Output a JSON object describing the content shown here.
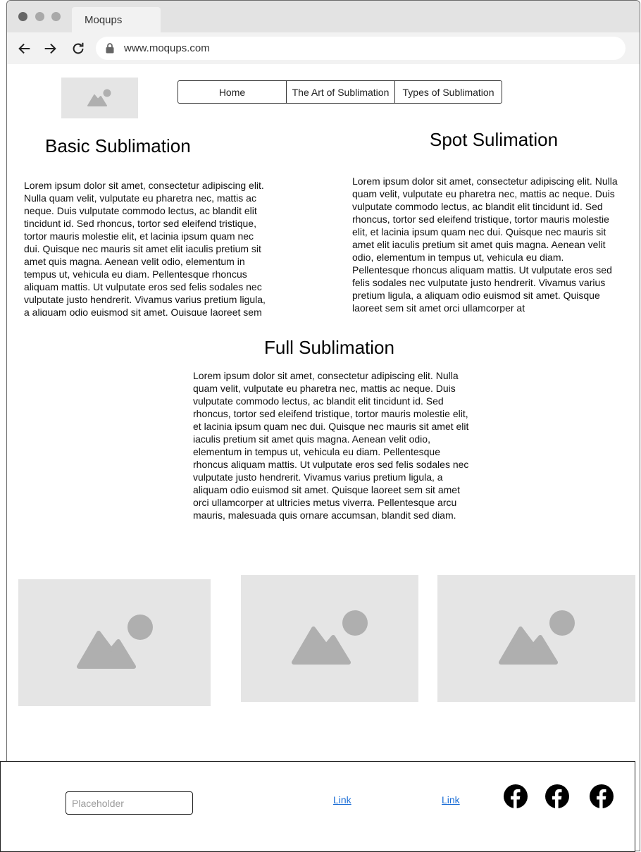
{
  "browser": {
    "tab_title": "Moqups",
    "url": "www.moqups.com"
  },
  "nav": {
    "items": [
      "Home",
      "The Art of Sublimation",
      "Types of Sublimation"
    ]
  },
  "sections": {
    "basic": {
      "title": "Basic Sublimation",
      "text": "Lorem ipsum dolor sit amet, consectetur adipiscing elit. Nulla quam velit, vulputate eu pharetra nec, mattis ac neque. Duis vulputate commodo lectus, ac blandit elit tincidunt id. Sed rhoncus, tortor sed eleifend tristique, tortor mauris molestie elit, et lacinia ipsum quam nec dui. Quisque nec mauris sit amet elit iaculis pretium sit amet quis magna. Aenean velit odio, elementum in tempus ut, vehicula eu diam. Pellentesque rhoncus aliquam mattis. Ut vulputate eros sed felis sodales nec vulputate justo hendrerit. Vivamus varius pretium ligula, a aliquam odio euismod sit amet. Quisque laoreet sem"
    },
    "spot": {
      "title": "Spot Sulimation",
      "text": "Lorem ipsum dolor sit amet, consectetur adipiscing elit. Nulla quam velit, vulputate eu pharetra nec, mattis ac neque. Duis vulputate commodo lectus, ac blandit elit tincidunt id. Sed rhoncus, tortor sed eleifend tristique, tortor mauris molestie elit, et lacinia ipsum quam nec dui. Quisque nec mauris sit amet elit iaculis pretium sit amet quis magna. Aenean velit odio, elementum in tempus ut, vehicula eu diam. Pellentesque rhoncus aliquam mattis. Ut vulputate eros sed felis sodales nec vulputate justo hendrerit. Vivamus varius pretium ligula, a aliquam odio euismod sit amet. Quisque laoreet sem sit amet orci ullamcorper at"
    },
    "full": {
      "title": "Full Sublimation",
      "text": "Lorem ipsum dolor sit amet, consectetur adipiscing elit. Nulla quam velit, vulputate eu pharetra nec, mattis ac neque. Duis vulputate commodo lectus, ac blandit elit tincidunt id. Sed rhoncus, tortor sed eleifend tristique, tortor mauris molestie elit, et lacinia ipsum quam nec dui. Quisque nec mauris sit amet elit iaculis pretium sit amet quis magna. Aenean velit odio, elementum in tempus ut, vehicula eu diam. Pellentesque rhoncus aliquam mattis. Ut vulputate eros sed felis sodales nec vulputate justo hendrerit. Vivamus varius pretium ligula, a aliquam odio euismod sit amet. Quisque laoreet sem sit amet orci ullamcorper at ultricies metus viverra. Pellentesque arcu mauris, malesuada quis ornare accumsan, blandit sed diam."
    }
  },
  "footer": {
    "input_placeholder": "Placeholder",
    "links": [
      "Link",
      "Link"
    ],
    "social_icons": [
      "facebook-icon",
      "facebook-icon",
      "facebook-icon"
    ]
  },
  "colors": {
    "placeholder_bg": "#e5e5e5",
    "placeholder_icon": "#afafaf",
    "link": "#1a6dd6"
  }
}
